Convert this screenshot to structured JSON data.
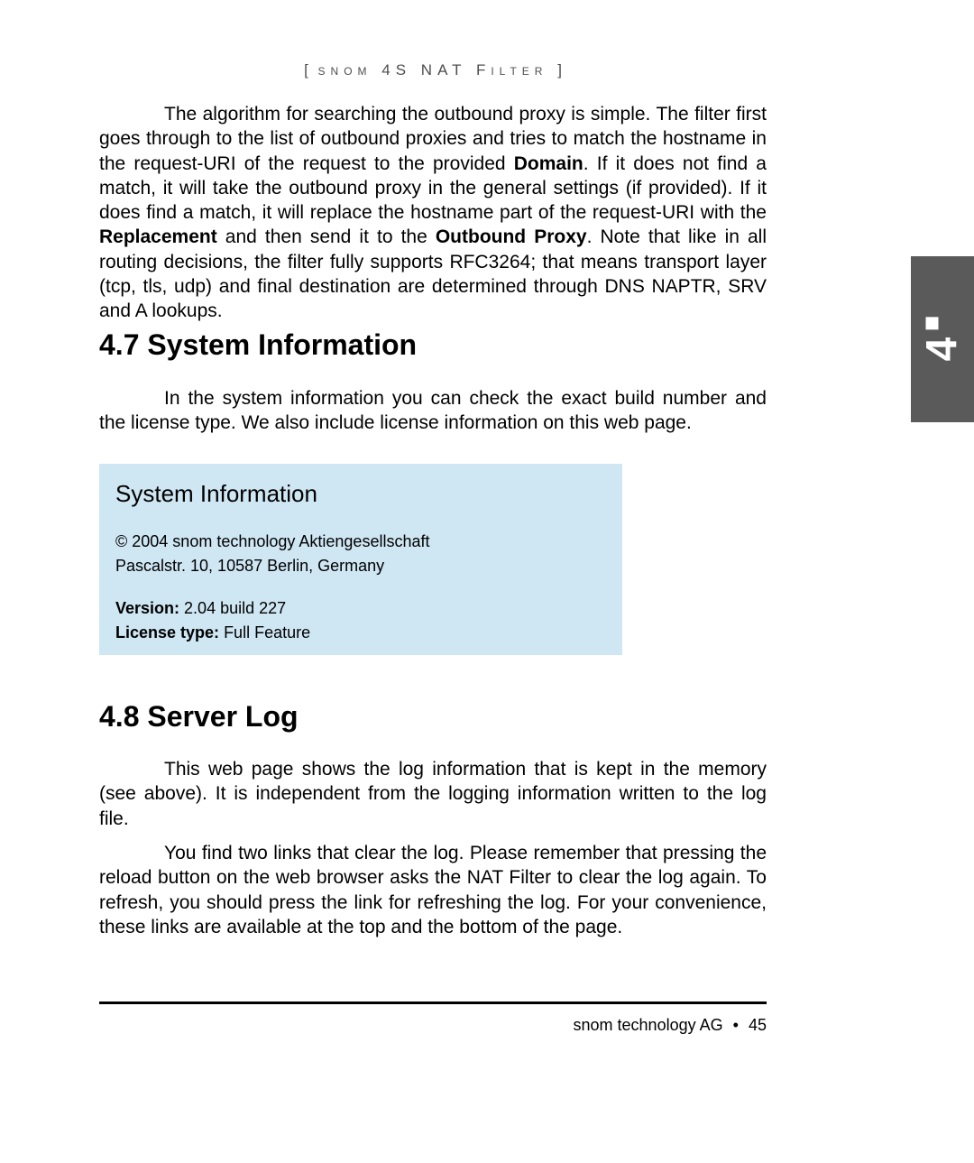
{
  "running_head": {
    "open": "[",
    "text": "snom 4S NAT Filter",
    "close": "]"
  },
  "chapter_tab": "4",
  "intro_paragraph_html": "The algorithm for searching the outbound proxy is simple. The filter first goes through to the list of outbound proxies and tries to match the hostname in the request-URI of the request to the provided <b>Domain</b>. If it does not find a match, it will take the outbound proxy in the general settings (if provided). If it does find a match, it will replace the hostname part of the request-URI with the <b>Replacement</b> and then send it to the <b>Outbound Proxy</b>. Note that like in all routing decisions, the filter fully supports RFC3264; that means transport layer (tcp, tls, udp) and final destination are determined through DNS NAPTR, SRV and A lookups.",
  "section_47": {
    "heading": "4.7  System Information",
    "paragraph": "In the system information you can check the exact build number and the license type. We also include license information on this web page."
  },
  "sysinfo_box": {
    "title": "System Information",
    "copyright": "© 2004 snom technology Aktiengesellschaft",
    "address": "Pascalstr. 10, 10587 Berlin, Germany",
    "version_label": "Version:",
    "version_value": "2.04 build 227",
    "license_label": "License type:",
    "license_value": "Full Feature"
  },
  "section_48": {
    "heading": "4.8  Server Log",
    "paragraph_a": "This web page shows the log information that is kept in the memory (see above). It is independent from the logging information written to the log file.",
    "paragraph_b": "You find two links that clear the log. Please remember that pressing the reload button on the web browser asks the NAT Filter to clear the log again. To refresh, you should press the link for refreshing the log. For your convenience, these links are available at the top and the bottom of the page."
  },
  "footer": {
    "publisher": "snom technology AG",
    "bullet": "•",
    "page": "45"
  }
}
